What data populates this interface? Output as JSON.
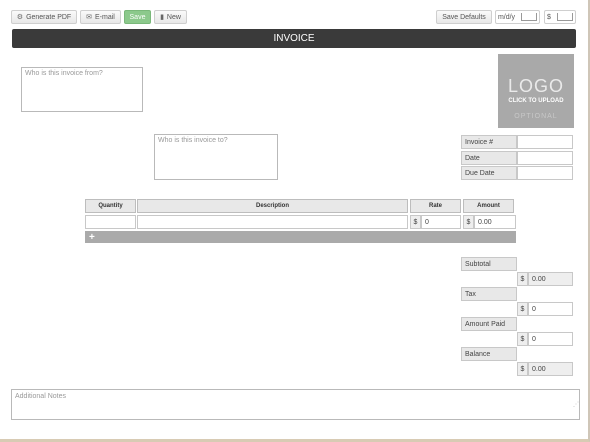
{
  "toolbar": {
    "generate_pdf": "Generate PDF",
    "email": "E-mail",
    "save": "Save",
    "new": "New",
    "save_defaults": "Save Defaults",
    "date_format": "m/d/y",
    "currency": "$"
  },
  "invoice_title": "INVOICE",
  "from_placeholder": "Who is this invoice from?",
  "to_placeholder": "Who is this invoice to?",
  "logo": {
    "text": "LOGO",
    "subtext": "CLICK TO UPLOAD",
    "optional": "OPTIONAL"
  },
  "meta_fields": [
    {
      "label": "Invoice #",
      "value": ""
    },
    {
      "label": "Date",
      "value": ""
    },
    {
      "label": "Due Date",
      "value": ""
    }
  ],
  "table": {
    "headers": [
      "Quantity",
      "Description",
      "Rate",
      "Amount"
    ],
    "row": {
      "quantity": "",
      "description": "",
      "rate_currency": "$",
      "rate": "0",
      "amount_currency": "$",
      "amount": "0.00"
    },
    "add_row_symbol": "+"
  },
  "totals": [
    {
      "label": "Subtotal",
      "currency": "$",
      "value": "0.00"
    },
    {
      "label": "Tax",
      "currency": "$",
      "value": "0"
    },
    {
      "label": "Amount Paid",
      "currency": "$",
      "value": "0"
    },
    {
      "label": "Balance",
      "currency": "$",
      "value": "0.00"
    }
  ],
  "notes_placeholder": "Additional Notes",
  "colors": {
    "title_bar": "#3a3a3a",
    "save_button": "#8cc98c",
    "logo_box": "#a9a9a9",
    "add_row_bar": "#aaaaaa"
  }
}
